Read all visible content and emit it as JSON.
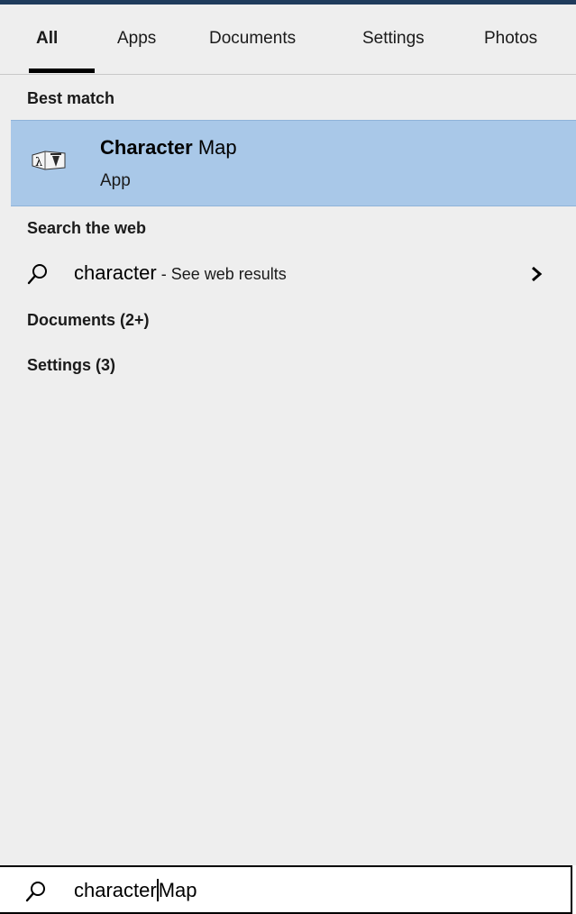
{
  "tabs": [
    {
      "label": "All",
      "active": true
    },
    {
      "label": "Apps"
    },
    {
      "label": "Documents"
    },
    {
      "label": "Settings"
    },
    {
      "label": "Photos"
    }
  ],
  "best_match": {
    "heading": "Best match",
    "app_name_bold": "Character",
    "app_name_rest": " Map",
    "app_type": "App",
    "icon": "character-map-icon"
  },
  "web": {
    "heading": "Search the web",
    "query": "character",
    "suffix": " - See web results",
    "icon": "search-icon"
  },
  "documents_group": "Documents (2+)",
  "settings_group": "Settings (3)",
  "search": {
    "typed": "character",
    "suggestion": "Map",
    "icon": "search-icon"
  },
  "colors": {
    "panel": "#eeeeee",
    "highlight": "#a9c8e8"
  }
}
